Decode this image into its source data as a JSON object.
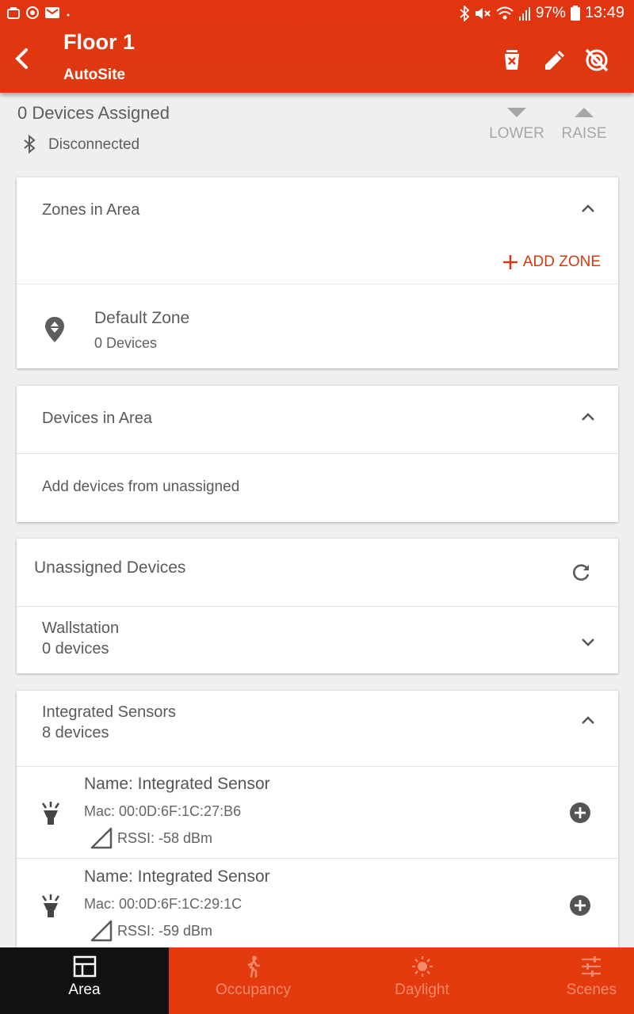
{
  "status_bar": {
    "battery": "97%",
    "time": "13:49"
  },
  "app_bar": {
    "title": "Floor 1",
    "subtitle": "AutoSite",
    "actions": [
      "delete-icon",
      "edit-icon",
      "no-signal-icon"
    ]
  },
  "area": {
    "assigned": "0 Devices Assigned",
    "connection": "Disconnected",
    "lower_label": "LOWER",
    "raise_label": "RAISE"
  },
  "zones_card": {
    "title": "Zones in Area",
    "add_label": "ADD ZONE",
    "zone_name": "Default Zone",
    "zone_count": "0 Devices"
  },
  "devices_card": {
    "title": "Devices in Area",
    "hint": "Add devices from unassigned"
  },
  "unassigned_card": {
    "title": "Unassigned Devices",
    "wallstation": {
      "name": "Wallstation",
      "count": "0 devices"
    },
    "sensors": {
      "name": "Integrated Sensors",
      "count": "8 devices"
    },
    "devices": [
      {
        "name": "Name: Integrated Sensor",
        "mac": "Mac: 00:0D:6F:1C:27:B6",
        "rssi": "RSSI: -58 dBm"
      },
      {
        "name": "Name: Integrated Sensor",
        "mac": "Mac: 00:0D:6F:1C:29:1C",
        "rssi": "RSSI: -59 dBm"
      }
    ]
  },
  "bottom_nav": [
    {
      "label": "Area",
      "icon": "area-icon",
      "active": true
    },
    {
      "label": "Occupancy",
      "icon": "occupancy-icon",
      "active": false
    },
    {
      "label": "Daylight",
      "icon": "daylight-icon",
      "active": false
    },
    {
      "label": "Scenes",
      "icon": "scenes-icon",
      "active": false
    }
  ],
  "colors": {
    "brand": "#e33a0e",
    "accent_text": "#d6380f",
    "background": "#eef0ef"
  }
}
